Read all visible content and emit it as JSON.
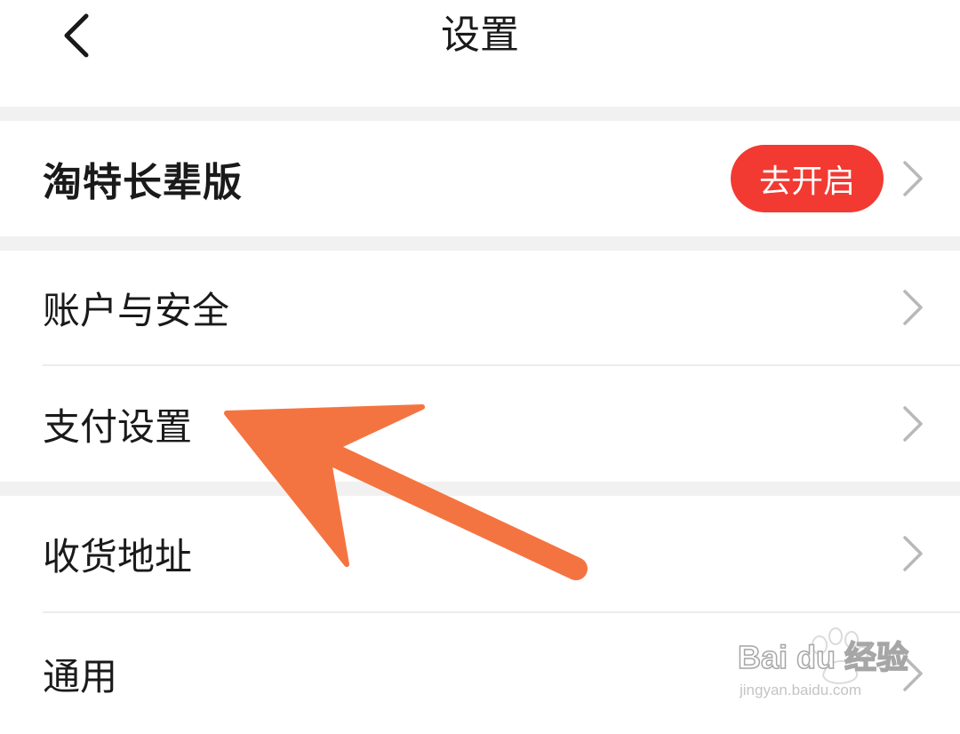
{
  "header": {
    "title": "设置",
    "back_icon": "chevron-left-icon"
  },
  "promo": {
    "label": "淘特长辈版",
    "action_label": "去开启",
    "action_color": "#f23a32"
  },
  "settings_items": [
    {
      "label": "账户与安全"
    },
    {
      "label": "支付设置"
    },
    {
      "label": "收货地址"
    },
    {
      "label": "通用"
    }
  ],
  "annotation": {
    "arrow_color": "#f47441",
    "points_to": "支付设置"
  },
  "watermark": {
    "brand": "Bai du 经验",
    "url": "jingyan.baidu.com"
  },
  "colors": {
    "background": "#ffffff",
    "section_gap": "#f1f1f1",
    "chevron": "#b8b8b8"
  }
}
